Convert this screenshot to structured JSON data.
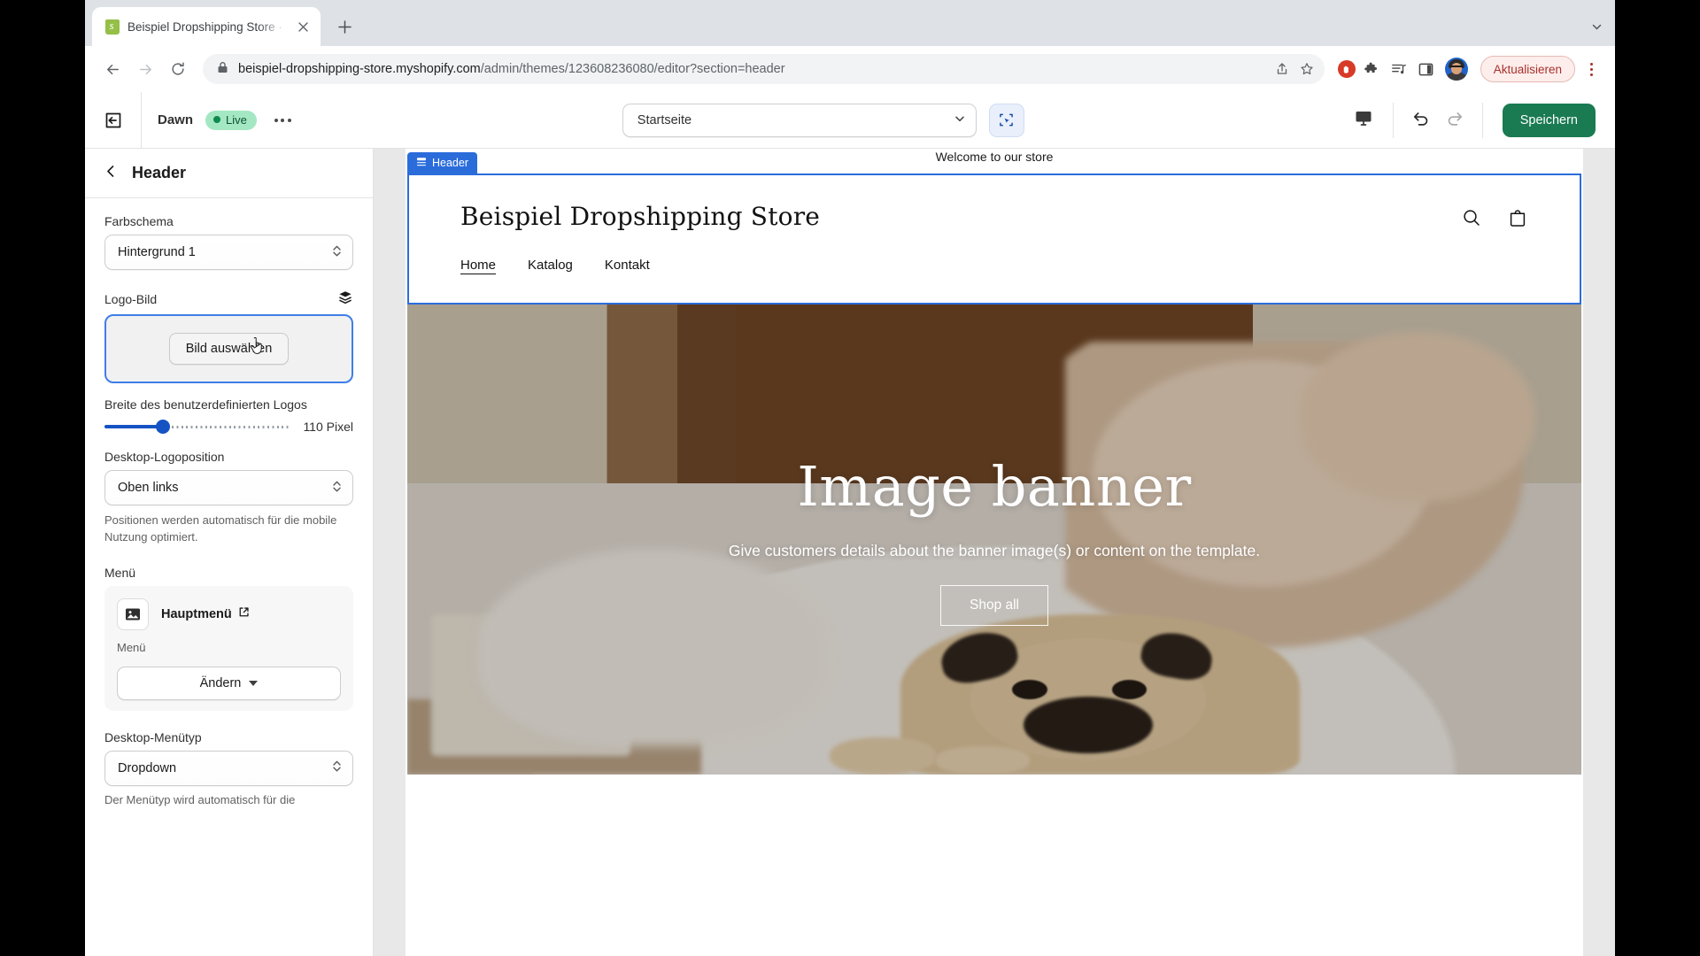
{
  "browser": {
    "tab": {
      "title": "Beispiel Dropshipping Store · D",
      "favicon": "shopify-logo-icon",
      "close": "close-icon"
    },
    "new_tab_label": "+",
    "nav": {
      "back": "back-arrow-icon",
      "forward": "forward-arrow-icon",
      "reload": "reload-icon"
    },
    "omnibox": {
      "lock": "lock-icon",
      "url_domain": "beispiel-dropshipping-store.myshopify.com",
      "url_path": "/admin/themes/123608236080/editor?section=header",
      "share": "share-icon",
      "bookmark": "star-icon"
    },
    "extensions": {
      "adblock": "adblock-hand-icon",
      "puzzle": "extensions-puzzle-icon",
      "reading_list": "media-list-icon",
      "side_panel": "side-panel-icon",
      "profile": "avatar-icon"
    },
    "update_button": "Aktualisieren",
    "menu": "chrome-menu-icon"
  },
  "editor": {
    "exit_icon": "exit-editor-icon",
    "theme_name": "Dawn",
    "live_badge": "Live",
    "more_icon": "more-options-icon",
    "page_selector": {
      "value": "Startseite",
      "caret": "chevron-down-icon"
    },
    "inspector_tool": "section-select-icon",
    "device_toggle": "desktop-icon",
    "undo": "undo-icon",
    "redo": "redo-icon",
    "save_button": "Speichern"
  },
  "sidebar": {
    "back_icon": "chevron-left-icon",
    "title": "Header",
    "color_scheme": {
      "label": "Farbschema",
      "value": "Hintergrund 1"
    },
    "logo_image": {
      "label": "Logo-Bild",
      "layers_icon": "layers-icon",
      "button": "Bild auswählen"
    },
    "logo_width": {
      "label": "Breite des benutzerdefinierten Logos",
      "value": "110 Pixel",
      "percent": 24
    },
    "logo_position": {
      "label": "Desktop-Logoposition",
      "value": "Oben links",
      "help": "Positionen werden automatisch für die mobile Nutzung optimiert."
    },
    "menu": {
      "label": "Menü",
      "item_icon": "image-placeholder-icon",
      "item_name": "Hauptmenü",
      "external_icon": "external-link-icon",
      "item_sub": "Menü",
      "change_button": "Ändern"
    },
    "desktop_menu_type": {
      "label": "Desktop-Menütyp",
      "value": "Dropdown",
      "help": "Der Menütyp wird automatisch für die"
    }
  },
  "preview": {
    "announcement": "Welcome to our store",
    "section_tag": {
      "icon": "section-icon",
      "label": "Header"
    },
    "store_title": "Beispiel Dropshipping Store",
    "nav": [
      {
        "label": "Home",
        "active": true
      },
      {
        "label": "Katalog",
        "active": false
      },
      {
        "label": "Kontakt",
        "active": false
      }
    ],
    "header_actions": {
      "search": "search-icon",
      "cart": "shopping-bag-icon"
    },
    "banner": {
      "heading": "Image banner",
      "paragraph": "Give customers details about the banner image(s) or content on the template.",
      "button": "Shop all"
    }
  },
  "colors": {
    "accent_blue": "#2b6cdb",
    "save_green": "#1a7a52",
    "live_green": "#a4e8c3",
    "slider_blue": "#1552c4",
    "update_red": "#a8302c"
  }
}
